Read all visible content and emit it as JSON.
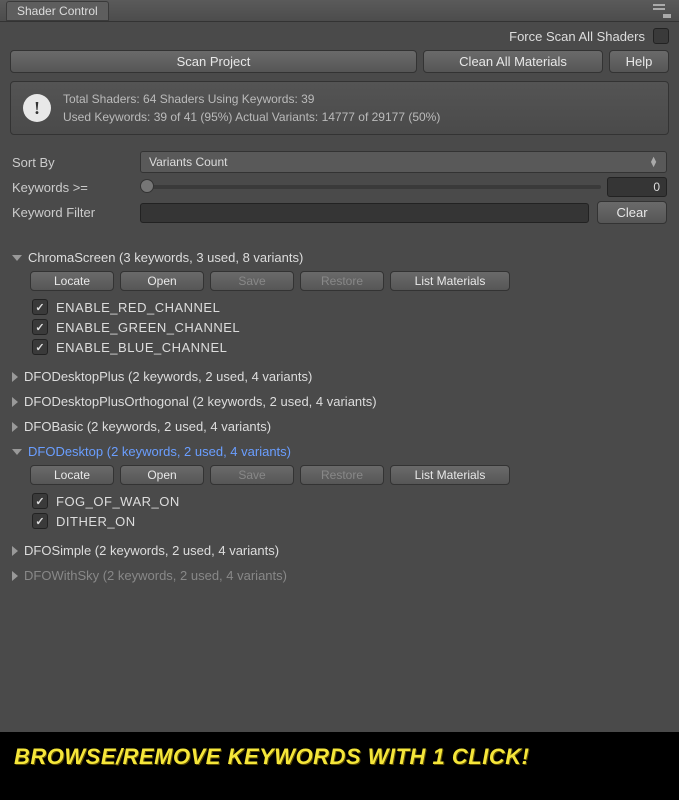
{
  "title": "Shader Control",
  "force_scan_label": "Force Scan All Shaders",
  "buttons": {
    "scan_project": "Scan Project",
    "clean_all": "Clean All Materials",
    "help": "Help",
    "clear": "Clear",
    "locate": "Locate",
    "open": "Open",
    "save": "Save",
    "restore": "Restore",
    "list_materials": "List Materials"
  },
  "info": {
    "line1": "Total Shaders: 64  Shaders Using Keywords: 39",
    "line2": "Used Keywords: 39 of 41 (95%)  Actual Variants: 14777 of 29177 (50%)"
  },
  "form": {
    "sort_by_label": "Sort By",
    "sort_by_value": "Variants Count",
    "keywords_ge_label": "Keywords >=",
    "keywords_ge_value": "0",
    "filter_label": "Keyword Filter",
    "filter_value": ""
  },
  "shaders": [
    {
      "name": "ChromaScreen",
      "summary": "(3 keywords, 3 used, 8 variants)",
      "expanded": true,
      "highlight": false,
      "keywords": [
        "ENABLE_RED_CHANNEL",
        "ENABLE_GREEN_CHANNEL",
        "ENABLE_BLUE_CHANNEL"
      ]
    },
    {
      "name": "DFODesktopPlus",
      "summary": "(2 keywords, 2 used, 4 variants)",
      "expanded": false
    },
    {
      "name": "DFODesktopPlusOrthogonal",
      "summary": "(2 keywords, 2 used, 4 variants)",
      "expanded": false
    },
    {
      "name": "DFOBasic",
      "summary": "(2 keywords, 2 used, 4 variants)",
      "expanded": false
    },
    {
      "name": "DFODesktop",
      "summary": "(2 keywords, 2 used, 4 variants)",
      "expanded": true,
      "highlight": true,
      "keywords": [
        "FOG_OF_WAR_ON",
        "DITHER_ON"
      ]
    },
    {
      "name": "DFOSimple",
      "summary": "(2 keywords, 2 used, 4 variants)",
      "expanded": false
    },
    {
      "name": "DFOWithSky",
      "summary": "(2 keywords, 2 used, 4 variants)",
      "expanded": false,
      "dim": true
    }
  ],
  "banner": "BROWSE/REMOVE KEYWORDS WITH 1 CLICK!"
}
